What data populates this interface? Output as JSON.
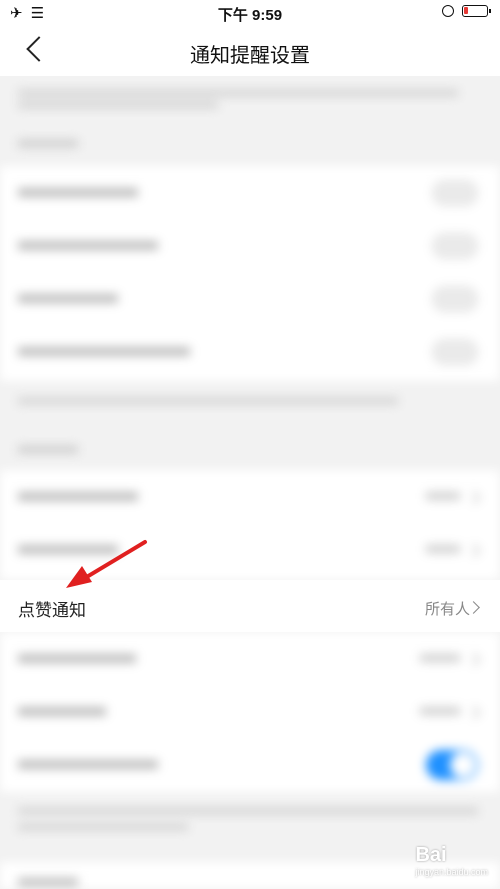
{
  "status_bar": {
    "left_icons": "✈ ☰",
    "time": "下午 9:59"
  },
  "nav": {
    "title": "通知提醒设置"
  },
  "focused_row": {
    "label": "点赞通知",
    "value": "所有人"
  },
  "watermark": {
    "text": "Bai",
    "sub": "jingyan.baidu.com"
  },
  "colors": {
    "arrow": "#e02020",
    "toggle_on": "#1e90ff"
  }
}
